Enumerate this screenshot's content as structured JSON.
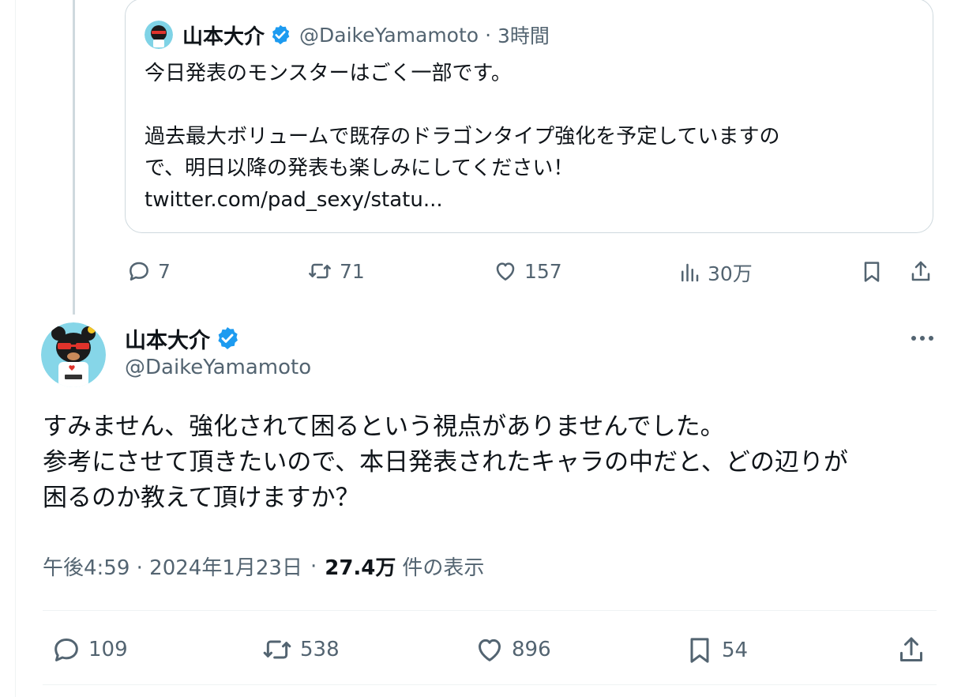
{
  "quoted_tweet": {
    "author_name": "山本大介",
    "handle": "@DaikeYamamoto",
    "separator": "·",
    "time": "3時間",
    "lines": [
      "今日発表のモンスターはごく一部です。",
      "",
      "過去最大ボリュームで既存のドラゴンタイプ強化を予定していますの",
      "で、明日以降の発表も楽しみにしてください！",
      "twitter.com/pad_sexy/statu..."
    ],
    "stats": {
      "replies": "7",
      "reposts": "71",
      "likes": "157",
      "views": "30万"
    }
  },
  "main_tweet": {
    "author_name": "山本大介",
    "handle": "@DaikeYamamoto",
    "lines": [
      "すみません、強化されて困るという視点がありませんでした。",
      "参考にさせて頂きたいので、本日発表されたキャラの中だと、どの辺りが",
      "困るのか教えて頂けますか？"
    ],
    "timestamp": "午後4:59 · 2024年1月23日",
    "meta_separator": "·",
    "views_count": "27.4万",
    "views_label": "件の表示",
    "stats": {
      "replies": "109",
      "reposts": "538",
      "likes": "896",
      "bookmarks": "54"
    }
  },
  "icons": [
    "reply-icon",
    "repost-icon",
    "like-icon",
    "views-icon",
    "bookmark-icon",
    "share-icon",
    "more-icon",
    "verified-badge-icon"
  ],
  "colors": {
    "text": "#0f1419",
    "secondary": "#536471",
    "verified": "#1d9bf0",
    "border": "#cfd9de"
  }
}
